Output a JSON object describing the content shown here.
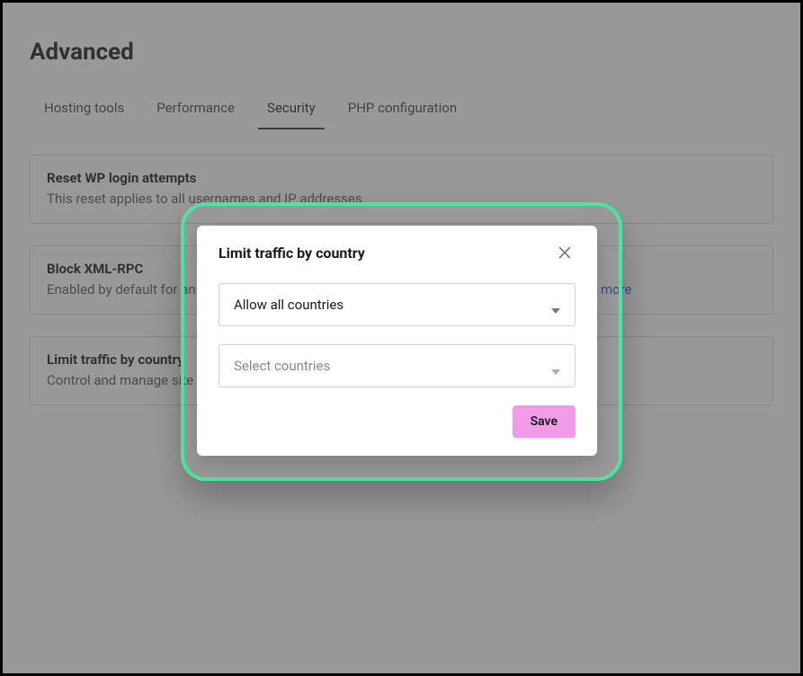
{
  "page": {
    "title": "Advanced"
  },
  "tabs": [
    {
      "label": "Hosting tools",
      "active": false
    },
    {
      "label": "Performance",
      "active": false
    },
    {
      "label": "Security",
      "active": true
    },
    {
      "label": "PHP configuration",
      "active": false
    }
  ],
  "cards": {
    "reset": {
      "title": "Reset WP login attempts",
      "desc": "This reset applies to all usernames and IP addresses."
    },
    "xmlrpc": {
      "title": "Block XML-RPC",
      "desc_pre": "Enabled by default for an added layer of protection when managing your site remotely. ",
      "link": "Learn more"
    },
    "limit": {
      "title": "Limit traffic by country",
      "desc": "Control and manage site protection by limiting traffic by country."
    }
  },
  "modal": {
    "title": "Limit traffic by country",
    "select1_value": "Allow all countries",
    "select2_placeholder": "Select countries",
    "save_label": "Save"
  }
}
